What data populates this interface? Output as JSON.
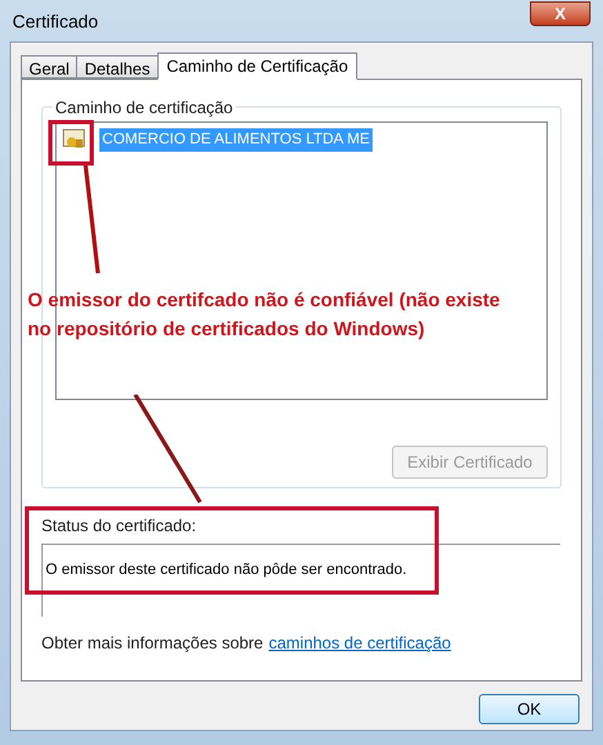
{
  "window": {
    "title": "Certificado",
    "close": "X"
  },
  "tabs": [
    {
      "label": "Geral",
      "selected": false
    },
    {
      "label": "Detalhes",
      "selected": false
    },
    {
      "label": "Caminho de Certificação",
      "selected": true
    }
  ],
  "path_group": {
    "label": "Caminho de certificação",
    "items": [
      {
        "label": "COMERCIO DE ALIMENTOS LTDA ME",
        "selected": true
      }
    ],
    "button": {
      "label": "Exibir Certificado",
      "disabled": true
    }
  },
  "status": {
    "label": "Status do certificado:",
    "text": "O emissor deste certificado não pôde ser encontrado."
  },
  "info": {
    "text": "Obter mais informações sobre",
    "link": "caminhos de certificação"
  },
  "annotation": {
    "text": "O emissor do certifcado não é confiável (não existe no repositório de certificados do Windows)"
  },
  "buttons": [
    {
      "label": "OK"
    }
  ]
}
